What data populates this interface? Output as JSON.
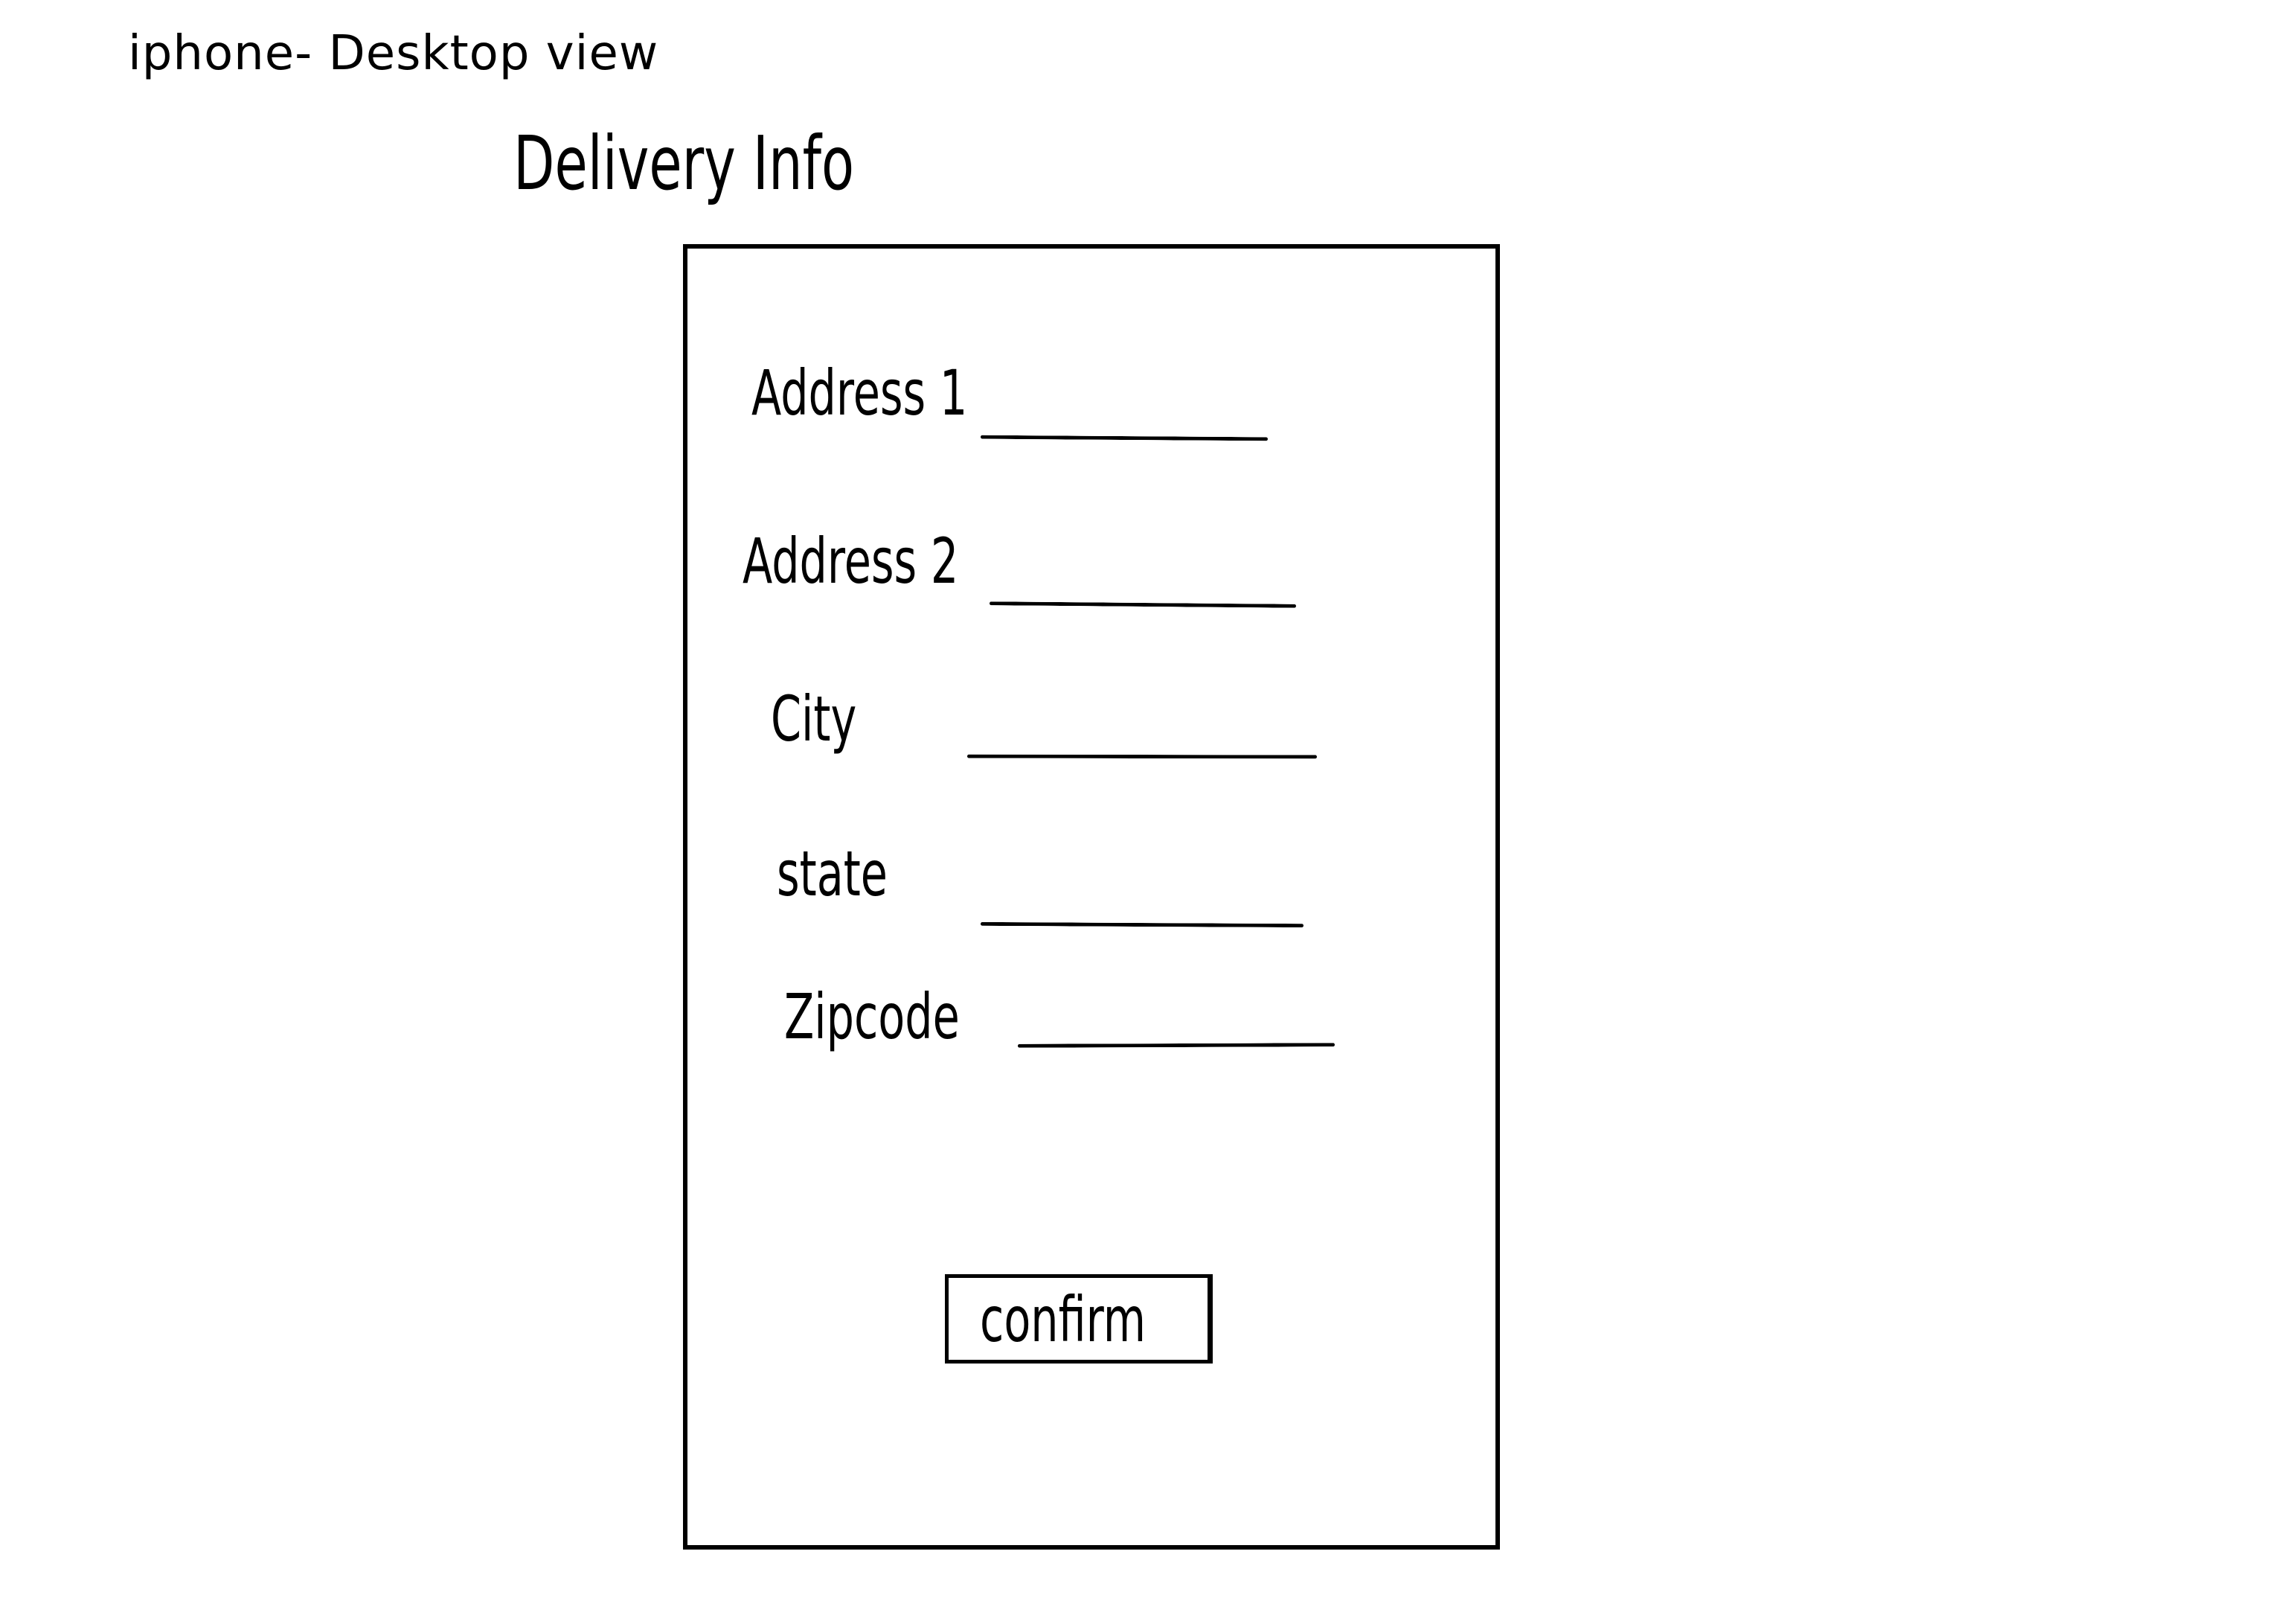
{
  "sketch": {
    "title": "iphone- Desktop view"
  },
  "screen": {
    "heading": "Delivery Info",
    "fields": [
      {
        "label": "Address 1"
      },
      {
        "label": "Address 2"
      },
      {
        "label": "City"
      },
      {
        "label": "state"
      },
      {
        "label": "Zipcode"
      }
    ],
    "confirm_label": "confirm"
  },
  "colors": {
    "ink": "#000000",
    "paper": "#ffffff"
  }
}
